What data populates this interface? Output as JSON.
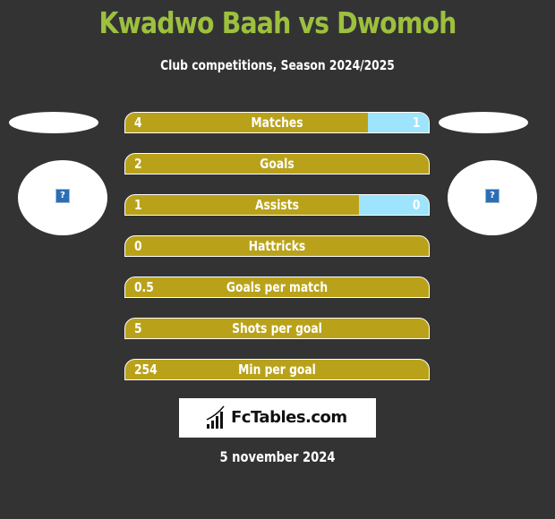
{
  "header": {
    "title": "Kwadwo Baah vs Dwomoh",
    "subtitle": "Club competitions, Season 2024/2025"
  },
  "players": {
    "left": {
      "avatar_icon": "missing-image-icon",
      "avatar_glyph": "?"
    },
    "right": {
      "avatar_icon": "missing-image-icon",
      "avatar_glyph": "?"
    }
  },
  "colors": {
    "background": "#333333",
    "title": "#9dc03e",
    "left_bar": "#b9a21a",
    "right_bar": "#9de4fc",
    "text": "#ffffff"
  },
  "stats": [
    {
      "label": "Matches",
      "left": "4",
      "right": "1",
      "right_share": 0.2
    },
    {
      "label": "Goals",
      "left": "2",
      "right": "",
      "right_share": 0
    },
    {
      "label": "Assists",
      "left": "1",
      "right": "0",
      "right_share": 0.23
    },
    {
      "label": "Hattricks",
      "left": "0",
      "right": "",
      "right_share": 0
    },
    {
      "label": "Goals per match",
      "left": "0.5",
      "right": "",
      "right_share": 0
    },
    {
      "label": "Shots per goal",
      "left": "5",
      "right": "",
      "right_share": 0
    },
    {
      "label": "Min per goal",
      "left": "254",
      "right": "",
      "right_share": 0
    }
  ],
  "footer": {
    "logo_text": "FcTables.com",
    "logo_icon": "bar-chart-icon",
    "date": "5 november 2024"
  }
}
